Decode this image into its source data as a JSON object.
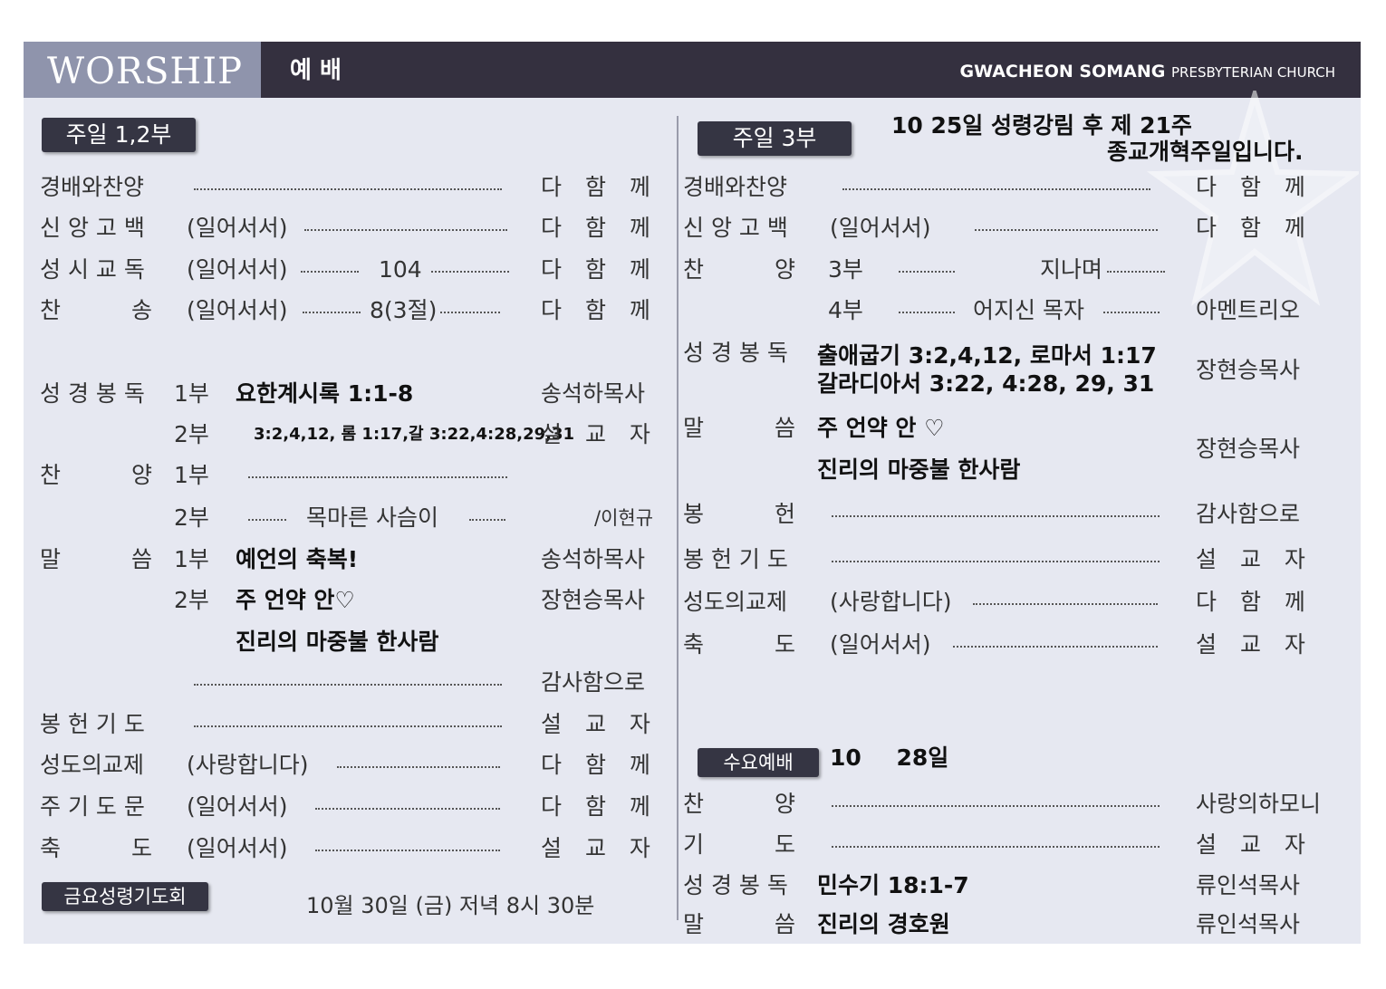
{
  "header": {
    "worship_en": "WORSHIP",
    "worship_ko": "예 배",
    "church_main": "GWACHEON SOMANG",
    "church_sub": "PRESBYTERIAN CHURCH"
  },
  "left": {
    "badge": "주일 1,2부",
    "rows": {
      "r1": {
        "label": "경배와찬양",
        "who": "다 함 께"
      },
      "r2": {
        "label": "신 앙 고 백",
        "note": "(일어서서)",
        "who": "다 함 께"
      },
      "r3": {
        "label": "성 시 교 독",
        "note": "(일어서서)",
        "num": "104",
        "who": "다 함 께"
      },
      "r4": {
        "label": "찬 송",
        "note": "(일어서서)",
        "num": "8(3절)",
        "who": "다 함 께"
      },
      "r5": {
        "label": "성 경 봉 독",
        "part": "1부",
        "text": "요한계시록 1:1-8",
        "who": "송석하목사"
      },
      "r6": {
        "part": "2부",
        "text": "3:2,4,12, 롬 1:17,갈 3:22,4:28,29,31",
        "who": "설 교 자"
      },
      "r7": {
        "label": "찬 양",
        "part": "1부"
      },
      "r8": {
        "part": "2부",
        "text": "목마른 사슴이",
        "who": "/이현규"
      },
      "r9": {
        "label": "말 씀",
        "part": "1부",
        "text": "예언의 축복!",
        "who": "송석하목사"
      },
      "r10": {
        "part": "2부",
        "text": "주 언약 안♡",
        "who": "장현승목사"
      },
      "r11": {
        "text": "진리의 마중불 한사람"
      },
      "r12": {
        "who": "감사함으로"
      },
      "r13": {
        "label": "봉 헌 기 도",
        "who": "설 교 자"
      },
      "r14": {
        "label": "성도의교제",
        "note": "(사랑합니다)",
        "who": "다 함 께"
      },
      "r15": {
        "label": "주 기 도 문",
        "note": "(일어서서)",
        "who": "다 함 께"
      },
      "r16": {
        "label": "축 도",
        "note": "(일어서서)",
        "who": "설 교 자"
      }
    },
    "friday_badge": "금요성령기도회",
    "friday_text": "10월 30일 (금) 저녁 8시 30분"
  },
  "right": {
    "badge": "주일 3부",
    "notice_line1": "10 25일 성령강림 후 제 21주",
    "notice_line2": "종교개혁주일입니다.",
    "rows": {
      "r1": {
        "label": "경배와찬양",
        "who": "다 함 께"
      },
      "r2": {
        "label": "신 앙 고 백",
        "note": "(일어서서)",
        "who": "다 함 께"
      },
      "r3": {
        "label": "찬 양",
        "part": "3부",
        "text": "지나며"
      },
      "r4": {
        "part": "4부",
        "text": "어지신 목자",
        "who": "아멘트리오"
      },
      "r5": {
        "label": "성 경 봉 독",
        "text1": "출애굽기 3:2,4,12, 로마서 1:17",
        "text2": "갈라디아서 3:22, 4:28, 29, 31",
        "who": "장현승목사"
      },
      "r6": {
        "label": "말 씀",
        "text1": "주 언약 안 ♡",
        "text2": "진리의 마중불 한사람",
        "who": "장현승목사"
      },
      "r7": {
        "label": "봉 헌",
        "who": "감사함으로"
      },
      "r8": {
        "label": "봉 헌 기 도",
        "who": "설 교 자"
      },
      "r9": {
        "label": "성도의교제",
        "note": "(사랑합니다)",
        "who": "다 함 께"
      },
      "r10": {
        "label": "축 도",
        "note": "(일어서서)",
        "who": "설 교 자"
      }
    },
    "wed_badge": "수요예배",
    "wed_date": "10 28일",
    "wed_rows": {
      "r1": {
        "label": "찬 양",
        "who": "사랑의하모니"
      },
      "r2": {
        "label": "기 도",
        "who": "설 교 자"
      },
      "r3": {
        "label": "성 경 봉 독",
        "text": "민수기 18:1-7",
        "who": "류인석목사"
      },
      "r4": {
        "label": "말 씀",
        "text": "진리의 경호원",
        "who": "류인석목사"
      }
    }
  }
}
